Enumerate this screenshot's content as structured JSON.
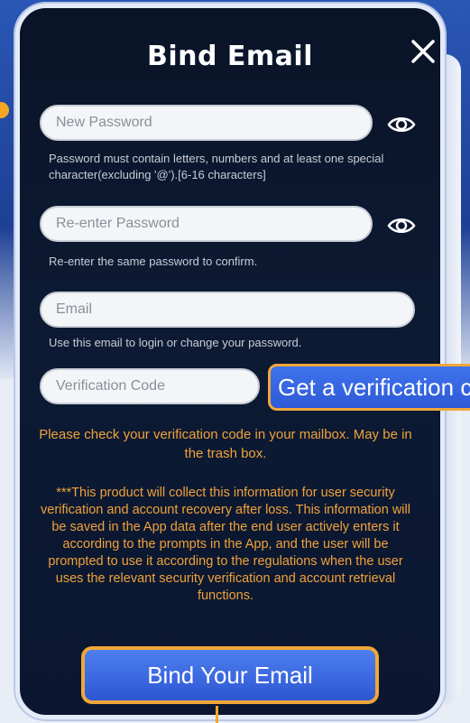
{
  "dialog": {
    "title": "Bind Email",
    "close_icon": "close-icon"
  },
  "fields": {
    "new_password": {
      "placeholder": "New Password",
      "hint": "Password must contain letters, numbers and at least one special character(excluding '@').[6-16 characters]",
      "icon": "eye-icon"
    },
    "reenter_password": {
      "placeholder": "Re-enter Password",
      "hint": "Re-enter the same password to confirm.",
      "icon": "eye-icon"
    },
    "email": {
      "placeholder": "Email",
      "hint": "Use this email to login or change your password."
    },
    "verification_code": {
      "placeholder": "Verification Code"
    }
  },
  "buttons": {
    "get_code_label": "Get a verification code",
    "bind_label": "Bind Your Email"
  },
  "notices": {
    "mailbox": "Please check your verification code in your mailbox. May be in the trash box.",
    "privacy": "***This product will collect this information for user security verification and account recovery after loss. This information will be saved in the App data after the end user actively enters it according to the prompts in the App, and the user will be prompted to use it according to the regulations when the user uses the relevant security verification and account retrieval functions."
  },
  "colors": {
    "accent_orange": "#f0a23a",
    "button_blue": "#2e5ad6",
    "panel_dark": "#0b1730"
  }
}
